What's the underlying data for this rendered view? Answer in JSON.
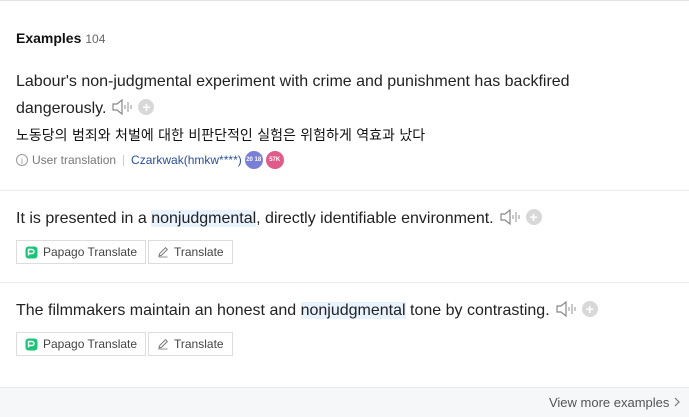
{
  "section": {
    "title": "Examples",
    "count": "104"
  },
  "examples": [
    {
      "line1": "Labour's non-judgmental experiment with crime and punishment has backfired",
      "line2": "dangerously.",
      "translation": "노동당의 범죄와 처벌에 대한 비판단적인 실험은 위험하게 역효과 났다",
      "source_label": "User translation",
      "user": "Czarkwak(hmkw****)",
      "badge_level": "20 18",
      "badge_points": "57K"
    },
    {
      "before": "It is presented in a ",
      "highlight": "nonjudgmental",
      "after": ", directly identifiable environment.",
      "papago_label": "Papago Translate",
      "translate_label": "Translate"
    },
    {
      "before": "The filmmakers maintain an honest and ",
      "highlight": "nonjudgmental",
      "after": " tone by contrasting.",
      "papago_label": "Papago Translate",
      "translate_label": "Translate"
    }
  ],
  "footer": {
    "more_label": "View more examples"
  },
  "icons": {
    "speaker": "speaker-icon",
    "add": "plus-icon",
    "info": "info-icon",
    "papago": "papago-logo-icon",
    "pencil": "pencil-icon",
    "chevron": "chevron-right-icon"
  },
  "colors": {
    "highlight": "#e8f3ff",
    "user_link": "#2a4e9f",
    "badge_level": "#7a7fd6",
    "badge_points": "#e05a8a"
  }
}
